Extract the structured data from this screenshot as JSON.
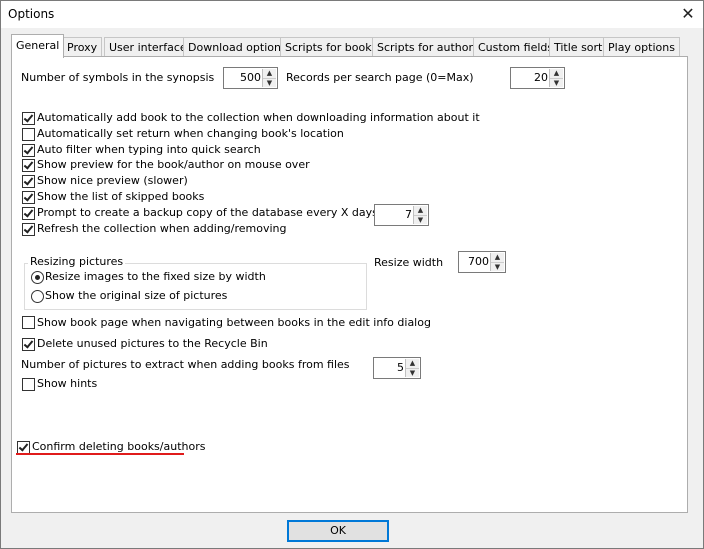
{
  "window": {
    "title": "Options",
    "close_glyph": "✕"
  },
  "tabs": [
    {
      "label": "General"
    },
    {
      "label": "Proxy"
    },
    {
      "label": "User interface"
    },
    {
      "label": "Download options"
    },
    {
      "label": "Scripts for books"
    },
    {
      "label": "Scripts for authors"
    },
    {
      "label": "Custom fields"
    },
    {
      "label": "Title sort"
    },
    {
      "label": "Play options"
    }
  ],
  "general": {
    "synopsis_symbols": {
      "label": "Number of symbols in the synopsis",
      "value": "500"
    },
    "records_per_page": {
      "label": "Records per search page (0=Max)",
      "value": "20"
    },
    "checkboxes": [
      {
        "label": "Automatically add book to the collection when downloading information about it",
        "checked": true
      },
      {
        "label": "Automatically set return when changing book's location",
        "checked": false
      },
      {
        "label": "Auto filter when typing into quick search",
        "checked": true
      },
      {
        "label": "Show preview for the book/author on mouse over",
        "checked": true
      },
      {
        "label": "Show nice preview (slower)",
        "checked": true
      },
      {
        "label": "Show the list of skipped books",
        "checked": true
      },
      {
        "label": "Prompt to create a backup copy of the database every X days:",
        "checked": true
      },
      {
        "label": "Refresh the collection when adding/removing",
        "checked": true
      }
    ],
    "backup_days": "7",
    "resizing": {
      "group_title": "Resizing pictures",
      "option_fixed": "Resize images to the fixed size by width",
      "option_original": "Show the original size of pictures",
      "selected": "fixed",
      "width_label": "Resize width",
      "width_value": "700"
    },
    "show_book_page": {
      "label": "Show book page when navigating between books in the edit info dialog",
      "checked": false
    },
    "delete_unused": {
      "label": "Delete unused pictures to the Recycle Bin",
      "checked": true
    },
    "pictures_extract": {
      "label": "Number of pictures to extract when adding books from files",
      "value": "5"
    },
    "show_hints": {
      "label": "Show hints",
      "checked": false
    },
    "confirm_delete": {
      "label": "Confirm deleting books/authors",
      "checked": true
    }
  },
  "footer": {
    "ok_label": "OK"
  },
  "colors": {
    "highlight_underline": "#e01b1b",
    "accent": "#0078d7"
  }
}
